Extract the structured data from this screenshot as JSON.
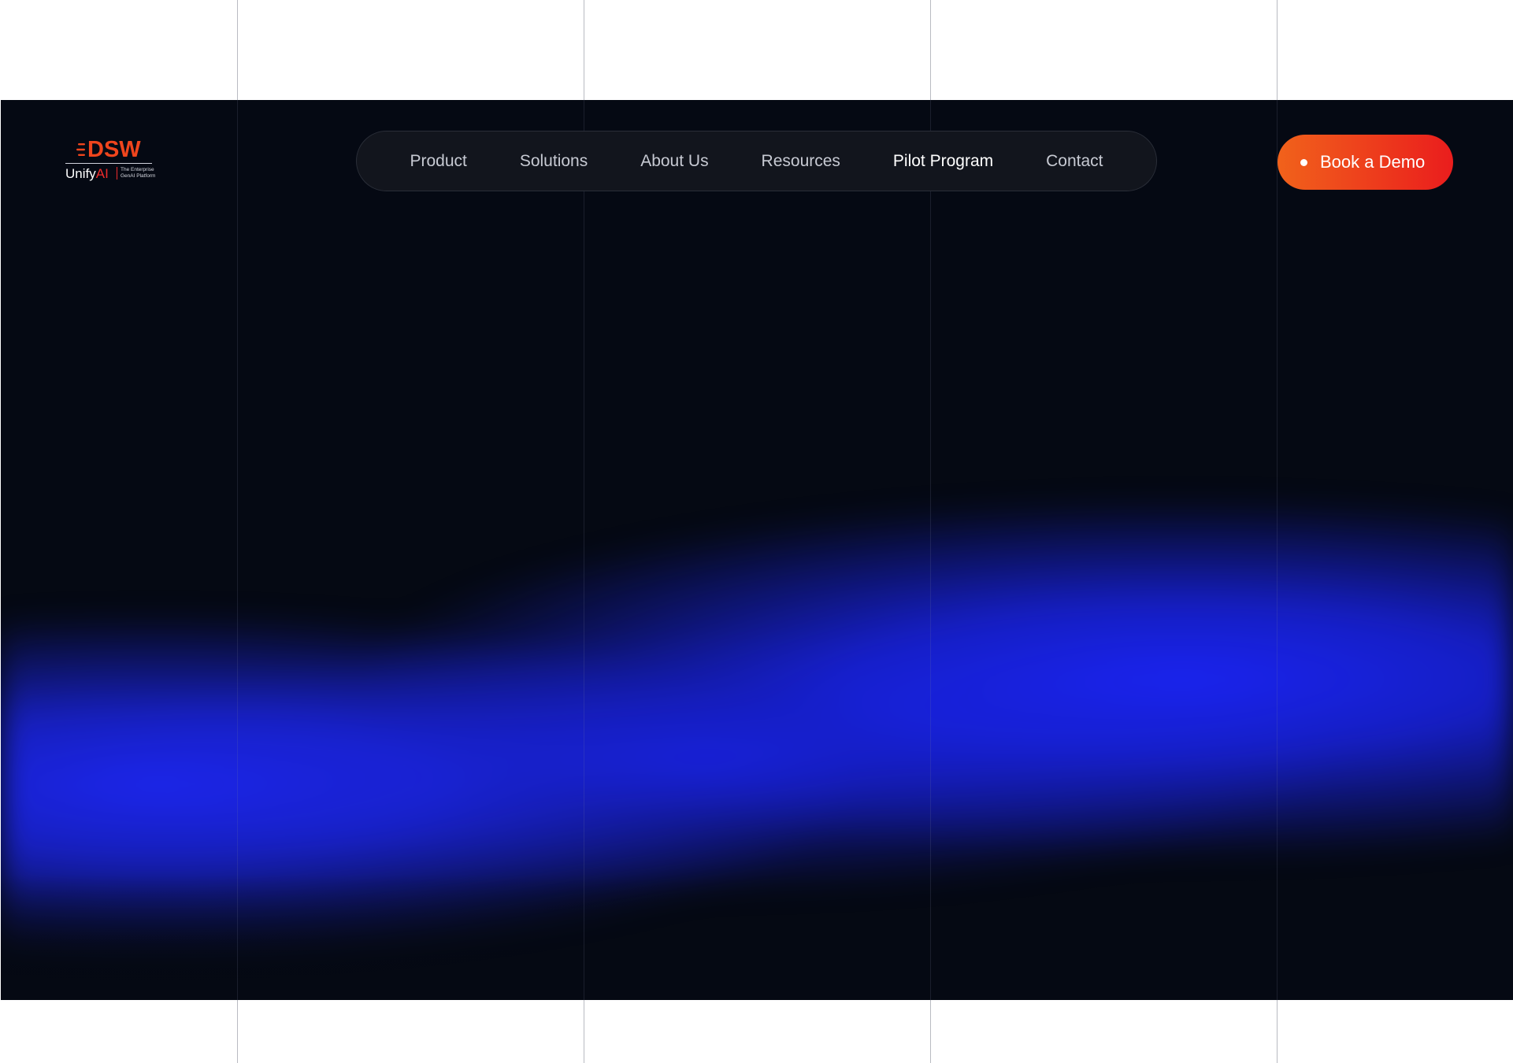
{
  "logo": {
    "mark": "DSW",
    "product_main": "Unify",
    "product_accent": "AI",
    "tagline_line1": "The Enterprise",
    "tagline_line2": "GenAI Platform"
  },
  "nav": {
    "items": [
      {
        "label": "Product",
        "active": false
      },
      {
        "label": "Solutions",
        "active": false
      },
      {
        "label": "About Us",
        "active": false
      },
      {
        "label": "Resources",
        "active": false
      },
      {
        "label": "Pilot Program",
        "active": true
      },
      {
        "label": "Contact",
        "active": false
      }
    ]
  },
  "cta": {
    "label": "Book a Demo"
  },
  "colors": {
    "background": "#050913",
    "accent_orange": "#f1621b",
    "accent_red": "#ea1d1d",
    "glow_blue": "#1a24f0"
  }
}
